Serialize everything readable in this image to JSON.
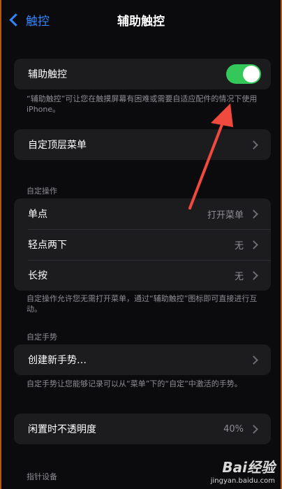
{
  "nav": {
    "back_label": "触控",
    "title": "辅助触控"
  },
  "main_toggle": {
    "label": "辅助触控",
    "state": "on",
    "description": "“辅助触控”可让您在触摸屏幕有困难或需要自适应配件的情况下使用iPhone。"
  },
  "top_menu": {
    "label": "自定顶层菜单"
  },
  "custom_actions": {
    "header": "自定操作",
    "items": [
      {
        "label": "单点",
        "value": "打开菜单"
      },
      {
        "label": "轻点两下",
        "value": "无"
      },
      {
        "label": "长按",
        "value": "无"
      }
    ],
    "description": "自定操作允许您无需打开菜单，通过“辅助触控”图标即可直接进行互动。"
  },
  "custom_gestures": {
    "header": "自定手势",
    "create_label": "创建新手势…",
    "description": "自定手势让您能够记录可以从“菜单”下的“自定”中激活的手势。"
  },
  "idle_opacity": {
    "label": "闲置时不透明度",
    "value": "40%"
  },
  "pointer_devices": {
    "header": "指针设备"
  },
  "watermark": {
    "brand": "Bai经验",
    "site": "jingyan.baidu.com"
  },
  "colors": {
    "accent_blue": "#2f86ff",
    "toggle_green": "#34c759",
    "arrow_red": "#f04a3e"
  }
}
